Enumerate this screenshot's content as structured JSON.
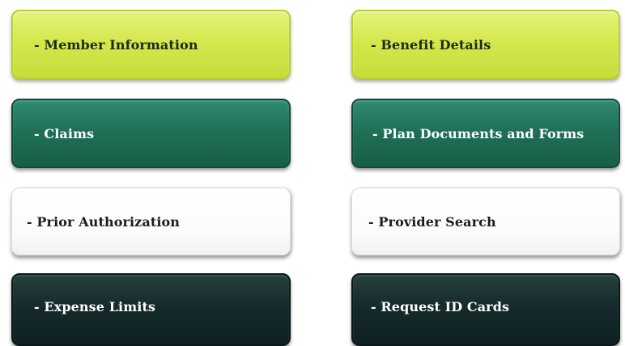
{
  "menu": {
    "tiles": [
      {
        "label": "- Member Information",
        "style": "lime",
        "color": "#d4e84e"
      },
      {
        "label": "- Benefit Details",
        "style": "lime",
        "color": "#d4e84e"
      },
      {
        "label": "- Claims",
        "style": "teal",
        "color": "#1f6e56"
      },
      {
        "label": "- Plan Documents and Forms",
        "style": "teal",
        "color": "#1f6e56"
      },
      {
        "label": "- Prior Authorization",
        "style": "white",
        "color": "#ffffff"
      },
      {
        "label": "- Provider Search",
        "style": "white",
        "color": "#ffffff"
      },
      {
        "label": "- Expense Limits",
        "style": "dark",
        "color": "#15292a"
      },
      {
        "label": "- Request ID Cards",
        "style": "dark",
        "color": "#15292a"
      }
    ]
  }
}
